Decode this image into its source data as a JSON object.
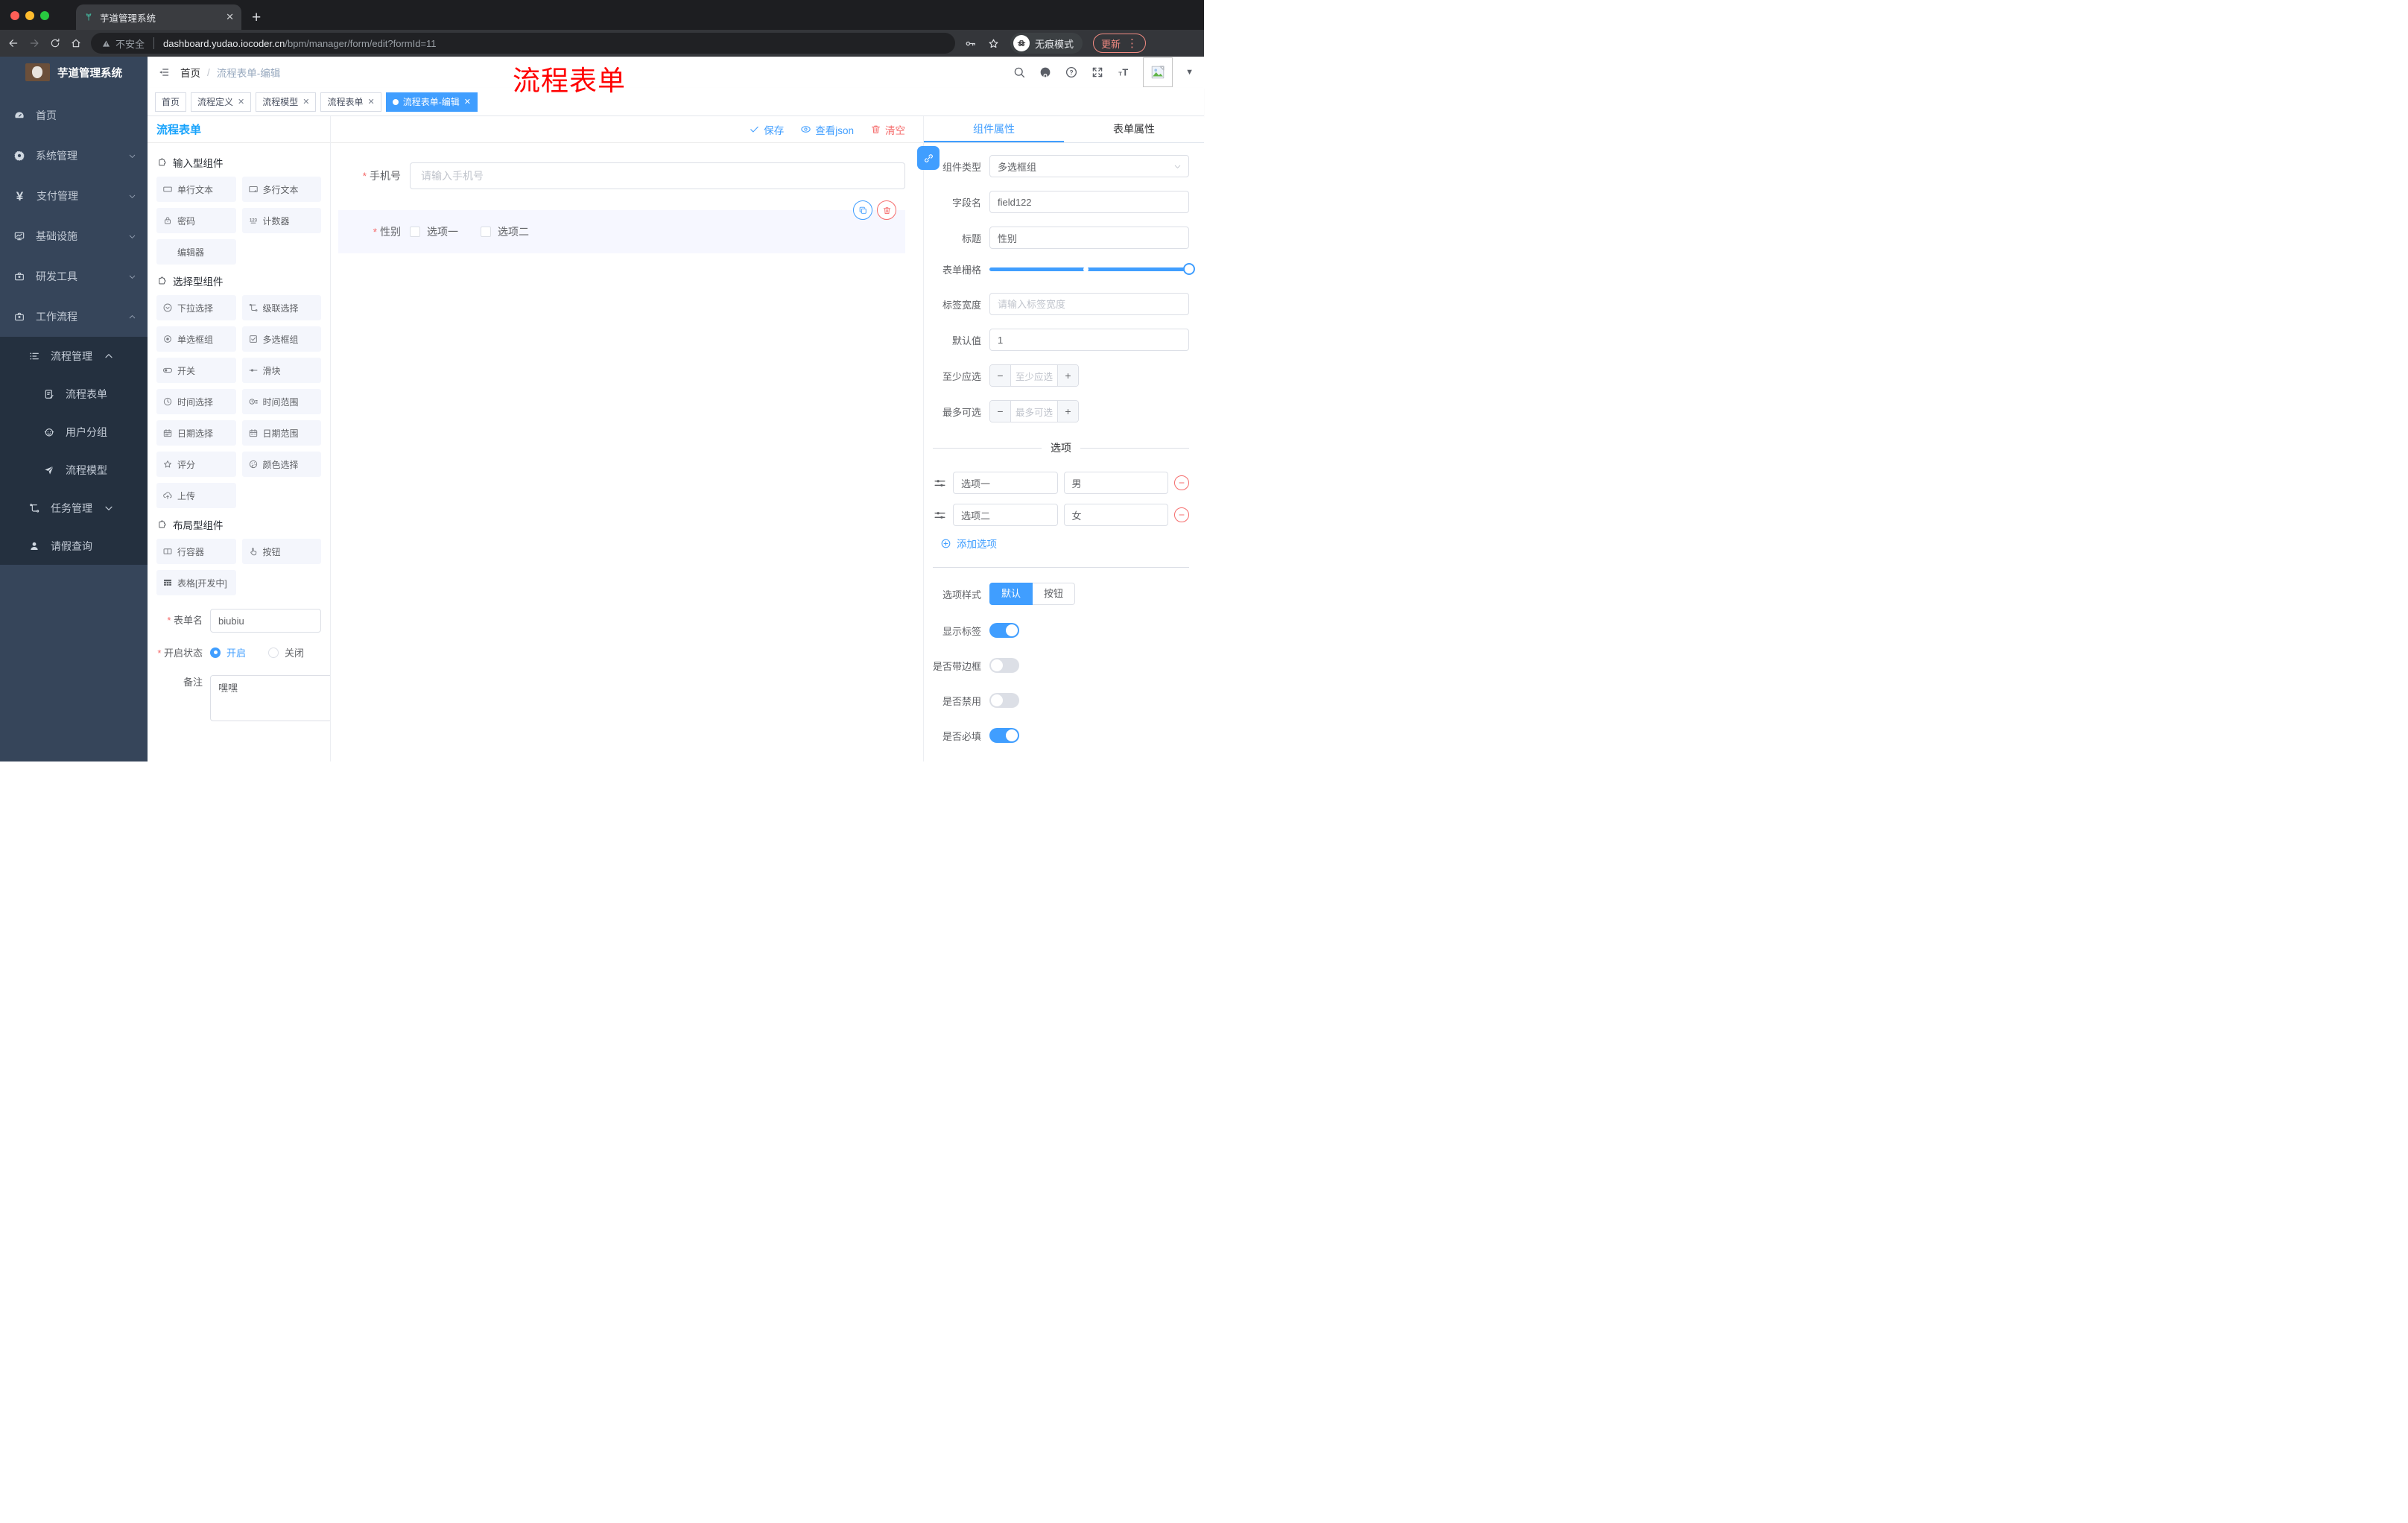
{
  "browser": {
    "tab_title": "芋道管理系统",
    "insecure": "不安全",
    "url_host": "dashboard.yudao.iocoder.cn",
    "url_path": "/bpm/manager/form/edit?formId=11",
    "incognito": "无痕模式",
    "update": "更新"
  },
  "header": {
    "breadcrumb_home": "首页",
    "breadcrumb_current": "流程表单-编辑",
    "overlay_annotation": "流程表单"
  },
  "tags": [
    {
      "label": "首页"
    },
    {
      "label": "流程定义"
    },
    {
      "label": "流程模型"
    },
    {
      "label": "流程表单"
    },
    {
      "label": "流程表单-编辑"
    }
  ],
  "sidebar": {
    "title": "芋道管理系统",
    "items": [
      {
        "label": "首页"
      },
      {
        "label": "系统管理"
      },
      {
        "label": "支付管理"
      },
      {
        "label": "基础设施"
      },
      {
        "label": "研发工具"
      },
      {
        "label": "工作流程"
      },
      {
        "label": "流程管理"
      },
      {
        "label": "流程表单"
      },
      {
        "label": "用户分组"
      },
      {
        "label": "流程模型"
      },
      {
        "label": "任务管理"
      },
      {
        "label": "请假查询"
      }
    ]
  },
  "palette": {
    "title": "流程表单",
    "sections": [
      {
        "title": "输入型组件",
        "items": [
          "单行文本",
          "多行文本",
          "密码",
          "计数器",
          "编辑器"
        ]
      },
      {
        "title": "选择型组件",
        "items": [
          "下拉选择",
          "级联选择",
          "单选框组",
          "多选框组",
          "开关",
          "滑块",
          "时间选择",
          "时间范围",
          "日期选择",
          "日期范围",
          "评分",
          "颜色选择",
          "上传"
        ]
      },
      {
        "title": "布局型组件",
        "items": [
          "行容器",
          "按钮",
          "表格[开发中]"
        ]
      }
    ],
    "form": {
      "name_label": "表单名",
      "name_value": "biubiu",
      "status_label": "开启状态",
      "status_on": "开启",
      "status_off": "关闭",
      "remark_label": "备注",
      "remark_value": "嘿嘿"
    }
  },
  "canvas": {
    "save": "保存",
    "view_json": "查看json",
    "clear": "清空",
    "phone_label": "手机号",
    "phone_placeholder": "请输入手机号",
    "gender_label": "性别",
    "gender_opt1": "选项一",
    "gender_opt2": "选项二"
  },
  "props": {
    "tab_component": "组件属性",
    "tab_form": "表单属性",
    "type_label": "组件类型",
    "type_value": "多选框组",
    "field_label": "字段名",
    "field_value": "field122",
    "title_label": "标题",
    "title_value": "性别",
    "grid_label": "表单栅格",
    "labelw_label": "标签宽度",
    "labelw_placeholder": "请输入标签宽度",
    "default_label": "默认值",
    "default_value": "1",
    "min_label": "至少应选",
    "min_placeholder": "至少应选",
    "max_label": "最多可选",
    "max_placeholder": "最多可选",
    "options_title": "选项",
    "options": [
      {
        "name": "选项一",
        "value": "男"
      },
      {
        "name": "选项二",
        "value": "女"
      }
    ],
    "add_option": "添加选项",
    "style_label": "选项样式",
    "style_default": "默认",
    "style_button": "按钮",
    "toggle_show_label": "显示标签",
    "toggle_border_label": "是否带边框",
    "toggle_disabled_label": "是否禁用",
    "toggle_required_label": "是否必填",
    "toggle_states": {
      "show_label": true,
      "border": false,
      "disabled": false,
      "required": true
    }
  },
  "colors": {
    "primary": "#409EFF",
    "danger": "#F56C6C",
    "panel_title_blue": "#18A3FC",
    "sidebar_bg": "#36455A",
    "submenu_bg": "#24303F"
  }
}
